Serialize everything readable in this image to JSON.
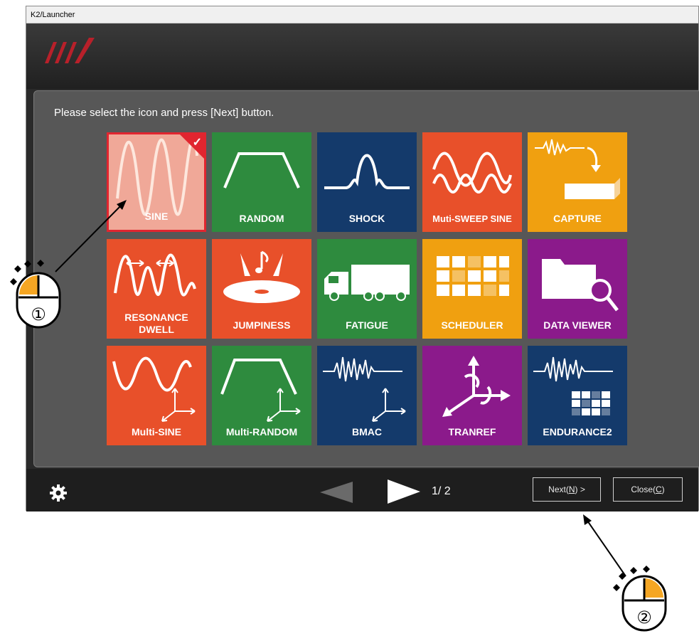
{
  "window": {
    "title": "K2/Launcher"
  },
  "instruction": "Please select the icon and press [Next] button.",
  "tiles": [
    {
      "label": "SINE",
      "color": "#e8502a",
      "selected": true,
      "icon": "sine-wave-icon"
    },
    {
      "label": "RANDOM",
      "color": "#2e8b3e",
      "icon": "trapezoid-icon"
    },
    {
      "label": "SHOCK",
      "color": "#143a6b",
      "icon": "shock-pulse-icon"
    },
    {
      "label": "Muti-SWEEP SINE",
      "color": "#e8502a",
      "icon": "double-sine-icon"
    },
    {
      "label": "CAPTURE",
      "color": "#f0a010",
      "icon": "capture-icon"
    },
    {
      "label": "RESONANCE",
      "label2": "DWELL",
      "color": "#e8502a",
      "icon": "resonance-icon"
    },
    {
      "label": "JUMPINESS",
      "color": "#e8502a",
      "icon": "jumpiness-icon"
    },
    {
      "label": "FATIGUE",
      "color": "#2e8b3e",
      "icon": "truck-icon"
    },
    {
      "label": "SCHEDULER",
      "color": "#f0a010",
      "icon": "scheduler-grid-icon"
    },
    {
      "label": "DATA VIEWER",
      "color": "#8b1a8b",
      "icon": "folder-magnifier-icon"
    },
    {
      "label": "Multi-SINE",
      "color": "#e8502a",
      "icon": "multi-sine-icon"
    },
    {
      "label": "Multi-RANDOM",
      "color": "#2e8b3e",
      "icon": "multi-random-icon"
    },
    {
      "label": "BMAC",
      "color": "#143a6b",
      "icon": "bmac-icon"
    },
    {
      "label": "TRANREF",
      "color": "#8b1a8b",
      "icon": "tranref-icon"
    },
    {
      "label": "ENDURANCE2",
      "color": "#143a6b",
      "icon": "endurance-icon"
    }
  ],
  "footer": {
    "page": "1/ 2",
    "next_label": "Next(",
    "next_key": "N",
    "next_tail": ") >",
    "close_label": "Close(",
    "close_key": "C",
    "close_tail": ")"
  },
  "annotations": {
    "step1": "①",
    "step2": "②"
  },
  "colors": {
    "accent": "#e1252f",
    "mouse": "#f5a623"
  }
}
